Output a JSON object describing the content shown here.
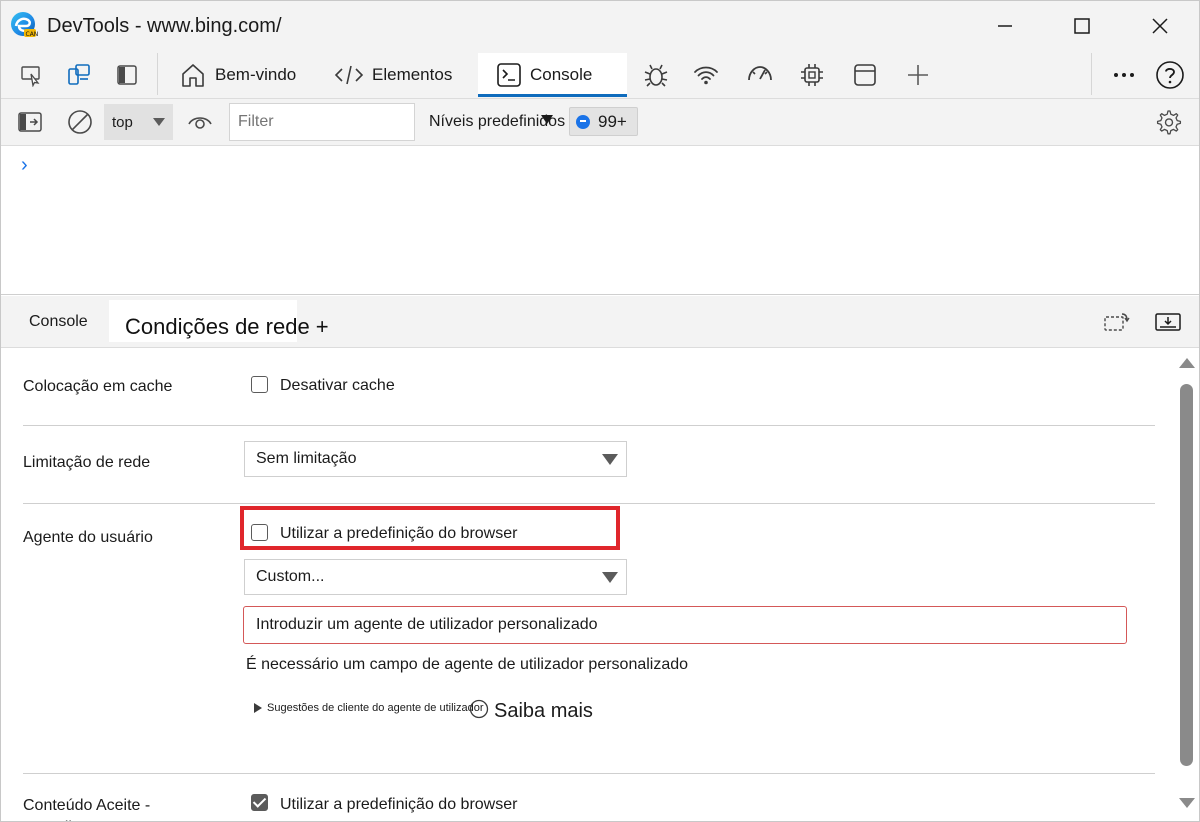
{
  "window": {
    "title": "DevTools - www.bing.com/"
  },
  "toolbar": {
    "tabs": [
      {
        "label": "Bem-vindo",
        "icon": "home-icon"
      },
      {
        "label": "Elementos",
        "icon": "code-icon"
      },
      {
        "label": "Console",
        "icon": "console-icon",
        "active": true
      }
    ]
  },
  "console_toolbar": {
    "context": "top",
    "filter_placeholder": "Filter",
    "levels": "Níveis predefinidos",
    "issues_count": "99+"
  },
  "console": {
    "prompt": "›"
  },
  "drawer": {
    "tabs": [
      {
        "label": "Console"
      },
      {
        "label": "Condições de rede +",
        "active": true
      }
    ]
  },
  "network_conditions": {
    "caching": {
      "label": "Colocação em cache",
      "checkbox_label": "Desativar cache",
      "checked": false
    },
    "throttling": {
      "label": "Limitação de rede",
      "value": "Sem limitação"
    },
    "user_agent": {
      "label": "Agente do usuário",
      "checkbox_label": "Utilizar a predefinição do browser",
      "checked": false,
      "select_value": "Custom...",
      "input_placeholder": "Introduzir um agente de utilizador personalizado",
      "error": "É necessário um campo de agente de utilizador personalizado",
      "hints": "Sugestões de cliente do agente de utilizador",
      "learn_more": "Saiba mais"
    },
    "accept_content": {
      "label": "Conteúdo Aceite - Encoding",
      "checkbox_label": "Utilizar a predefinição do browser",
      "checked": true
    }
  },
  "colors": {
    "accent": "#0f6cbd",
    "highlight": "#e0262b",
    "error_border": "#d45858"
  }
}
